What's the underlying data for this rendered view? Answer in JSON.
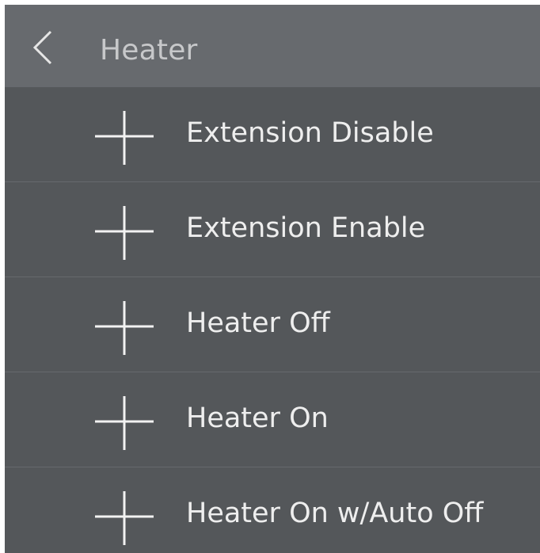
{
  "header": {
    "back_icon": "chevron-left-icon",
    "title": "Heater"
  },
  "list": {
    "item_icon": "plus-icon",
    "items": [
      {
        "label": "Extension Disable"
      },
      {
        "label": "Extension Enable"
      },
      {
        "label": "Heater Off"
      },
      {
        "label": "Heater On"
      },
      {
        "label": "Heater On w/Auto Off"
      }
    ]
  },
  "colors": {
    "header_bg": "#676a6e",
    "list_bg": "#54575a",
    "divider": "#66696d",
    "title_text": "#c7c8ca",
    "item_text": "#eeeeee",
    "icon": "#f2f2f2"
  }
}
